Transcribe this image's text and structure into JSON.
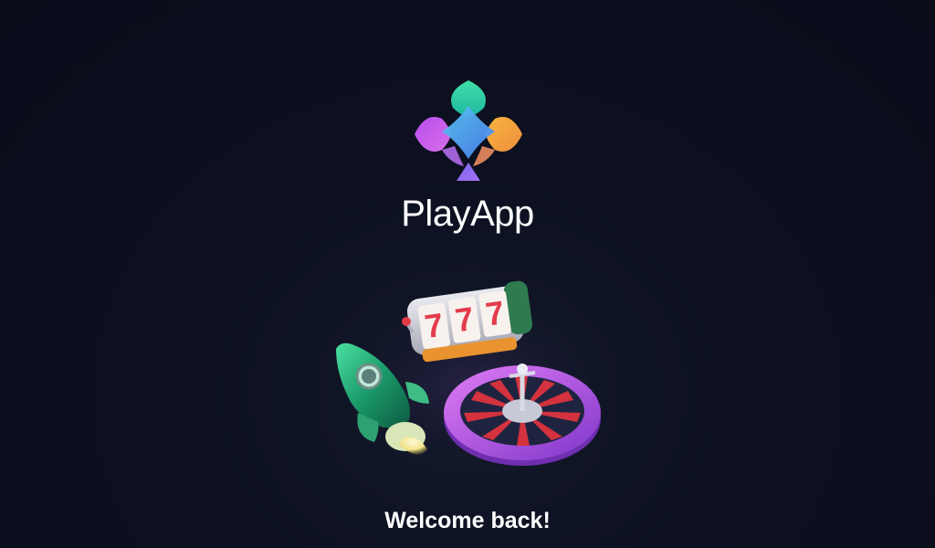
{
  "app": {
    "name": "PlayApp"
  },
  "logo": {
    "icon": "club-logo-icon",
    "colors": {
      "top": "#34d8a4",
      "left": "#c45cf0",
      "right": "#f3a53e",
      "center": "#4ca8f5",
      "stem": "#8f6df2"
    }
  },
  "illustration": {
    "slot_machine_digits": [
      "7",
      "7",
      "7"
    ],
    "items": [
      "rocket-icon",
      "slot-machine-icon",
      "roulette-wheel-icon"
    ]
  },
  "greeting": {
    "text": "Welcome back!"
  }
}
